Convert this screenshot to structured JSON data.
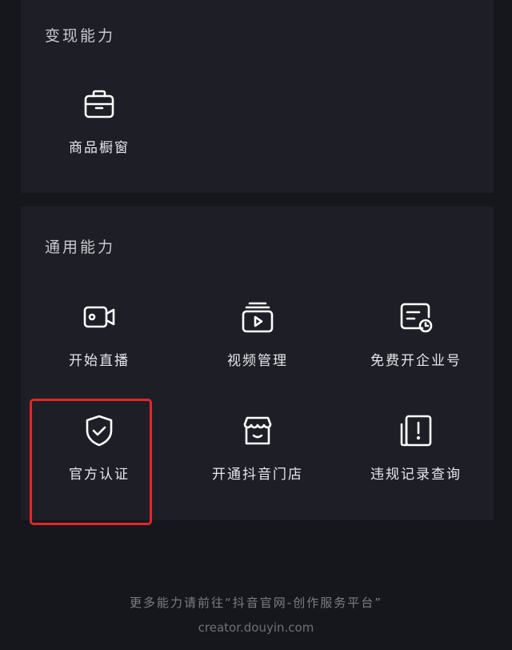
{
  "monetize": {
    "title": "变现能力",
    "items": [
      {
        "label": "商品橱窗",
        "icon": "shop-window-icon"
      }
    ]
  },
  "general": {
    "title": "通用能力",
    "items": [
      {
        "label": "开始直播",
        "icon": "video-camera-icon"
      },
      {
        "label": "视频管理",
        "icon": "video-library-icon"
      },
      {
        "label": "免费开企业号",
        "icon": "enterprise-account-icon"
      },
      {
        "label": "官方认证",
        "icon": "verified-shield-icon"
      },
      {
        "label": "开通抖音门店",
        "icon": "storefront-icon"
      },
      {
        "label": "违规记录查询",
        "icon": "violation-record-icon"
      }
    ]
  },
  "footer": {
    "text": "更多能力请前往“抖音官网-创作服务平台”",
    "url": "creator.douyin.com"
  },
  "colors": {
    "background": "#16171d",
    "card": "#1e1f26",
    "highlight": "#e2262a",
    "icon": "#ffffff"
  }
}
